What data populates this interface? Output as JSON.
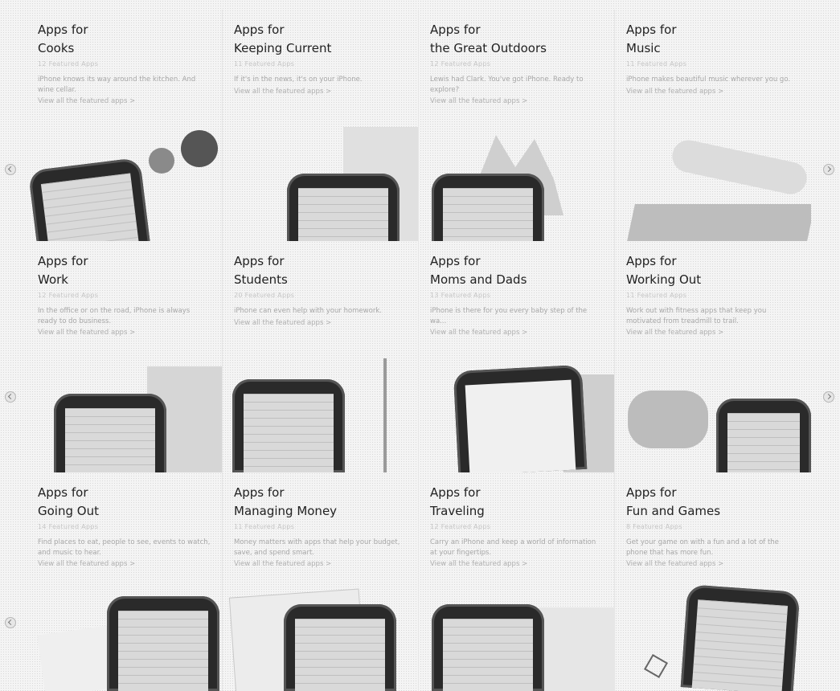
{
  "cards": [
    {
      "line1": "Apps for",
      "line2": "Cooks",
      "count": "12 Featured Apps",
      "desc": "iPhone knows its way around the kitchen. And wine cellar.",
      "link": "View all the featured apps >"
    },
    {
      "line1": "Apps for",
      "line2": "Keeping Current",
      "count": "11 Featured Apps",
      "desc": "If it's in the news, it's on your iPhone.",
      "link": "View all the featured apps >"
    },
    {
      "line1": "Apps for",
      "line2": "the Great Outdoors",
      "count": "12 Featured Apps",
      "desc": "Lewis had Clark. You've got iPhone. Ready to explore?",
      "link": "View all the featured apps >"
    },
    {
      "line1": "Apps for",
      "line2": "Music",
      "count": "11 Featured Apps",
      "desc": "iPhone makes beautiful music wherever you go.",
      "link": "View all the featured apps >"
    },
    {
      "line1": "Apps for",
      "line2": "Work",
      "count": "12 Featured Apps",
      "desc": "In the office or on the road, iPhone is always ready to do business.",
      "link": "View all the featured apps >"
    },
    {
      "line1": "Apps for",
      "line2": "Students",
      "count": "20 Featured Apps",
      "desc": "iPhone can even help with your homework.",
      "link": "View all the featured apps >"
    },
    {
      "line1": "Apps for",
      "line2": "Moms and Dads",
      "count": "13 Featured Apps",
      "desc": "iPhone is there for you every baby step of the wa...",
      "link": "View all the featured apps >"
    },
    {
      "line1": "Apps for",
      "line2": "Working Out",
      "count": "11 Featured Apps",
      "desc": "Work out with fitness apps that keep you motivated from treadmill to trail.",
      "link": "View all the featured apps >"
    },
    {
      "line1": "Apps for",
      "line2": "Going Out",
      "count": "14 Featured Apps",
      "desc": "Find places to eat, people to see, events to watch, and music to hear.",
      "link": "View all the featured apps >"
    },
    {
      "line1": "Apps for",
      "line2": "Managing Money",
      "count": "11 Featured Apps",
      "desc": "Money matters with apps that help your budget, save, and spend smart.",
      "link": "View all the featured apps >"
    },
    {
      "line1": "Apps for",
      "line2": "Traveling",
      "count": "12 Featured Apps",
      "desc": "Carry an iPhone and keep a world of information at your fingertips.",
      "link": "View all the featured apps >"
    },
    {
      "line1": "Apps for",
      "line2": "Fun and Games",
      "count": "8 Featured Apps",
      "desc": "Get your game on with a fun and a lot of the phone that has more fun.",
      "link": "View all the featured apps >"
    }
  ],
  "nav": {
    "prev_icon": "circle-arrow-left",
    "next_icon": "circle-arrow-right"
  }
}
